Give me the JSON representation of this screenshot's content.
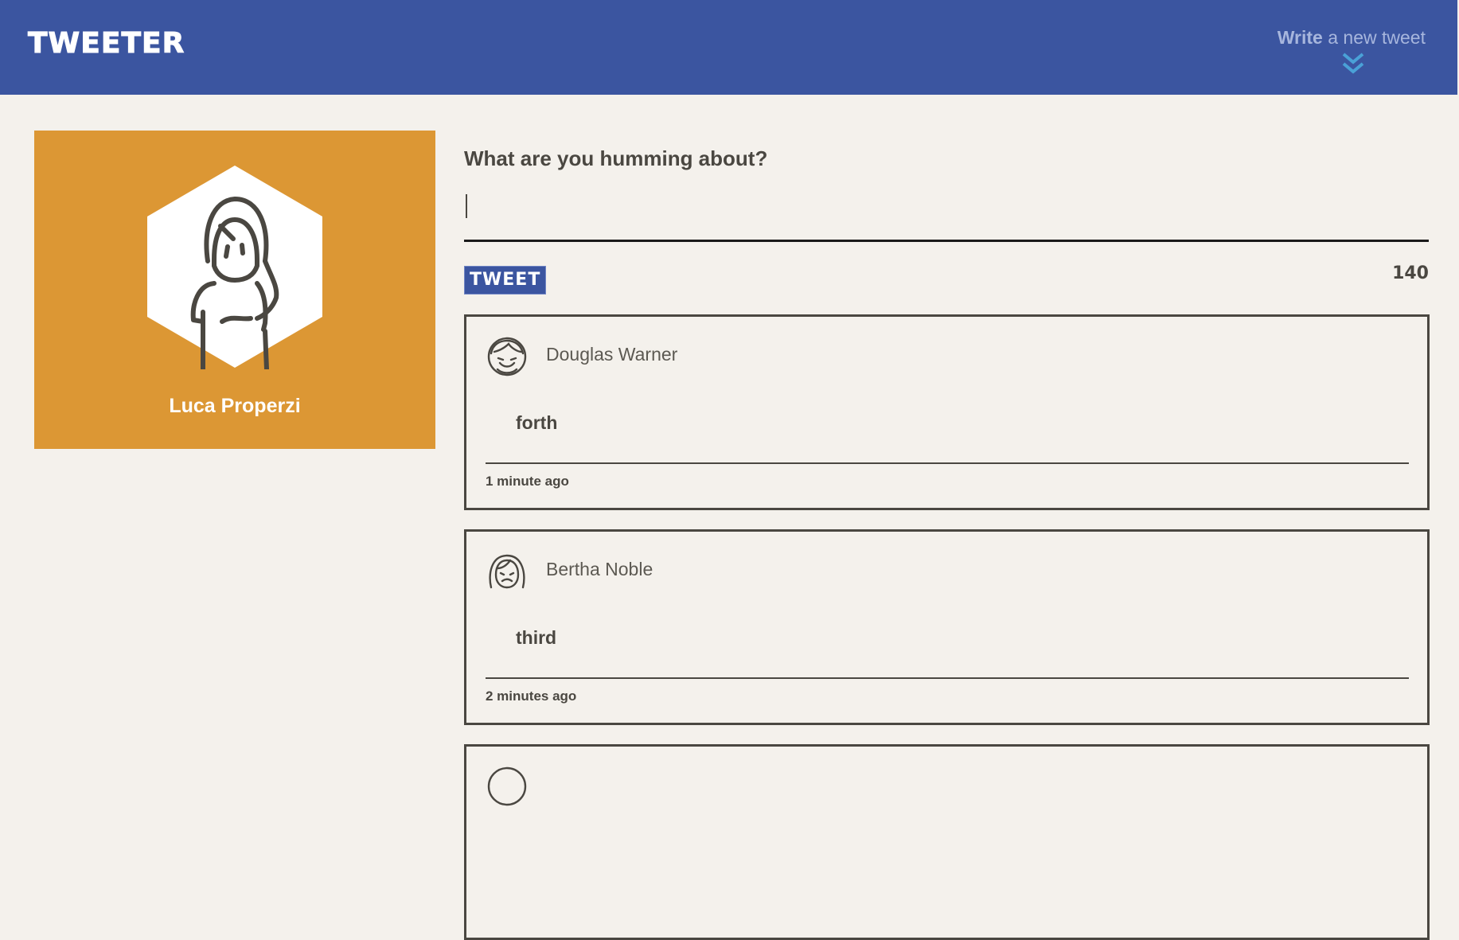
{
  "nav": {
    "brand": "Tweeter",
    "compose_strong": "Write",
    "compose_rest": " a new tweet",
    "chevron_icon": "double-chevron-down-icon"
  },
  "profile": {
    "name": "Luca Properzi",
    "avatar_icon": "woman-avatar-icon",
    "card_color": "#dc9734"
  },
  "composer": {
    "prompt": "What are you humming about?",
    "input_value": "",
    "button_label": "Tweet",
    "counter": "140"
  },
  "tweets": [
    {
      "author": "Douglas Warner",
      "avatar_icon": "smiling-man-avatar-icon",
      "text": "forth",
      "time": "1 minute ago"
    },
    {
      "author": "Bertha Noble",
      "avatar_icon": "sad-woman-avatar-icon",
      "text": "third",
      "time": "2 minutes ago"
    },
    {
      "author": "",
      "avatar_icon": "avatar-icon",
      "text": "",
      "time": ""
    }
  ],
  "colors": {
    "accent": "#3b55a0",
    "background": "#f4f1ec",
    "text": "#4a4741",
    "profile": "#dc9734"
  }
}
